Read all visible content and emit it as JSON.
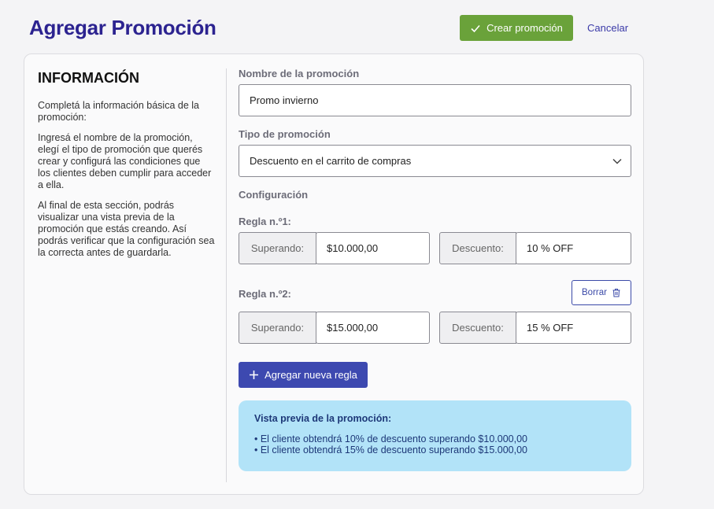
{
  "header": {
    "title": "Agregar Promoción",
    "create_label": "Crear promoción",
    "cancel_label": "Cancelar"
  },
  "info": {
    "title": "INFORMACIÓN",
    "paragraphs": [
      "Completá la información básica de la promoción:",
      "Ingresá el nombre de la promoción, elegí el tipo de promoción que querés crear y configurá las condiciones que los clientes deben cumplir para acceder a ella.",
      "Al final de esta sección, podrás visualizar una vista previa de la promoción que estás creando. Así podrás verificar que la configuración sea la correcta antes de guardarla."
    ]
  },
  "form": {
    "name_label": "Nombre de la promoción",
    "name_value": "Promo invierno",
    "type_label": "Tipo de promoción",
    "type_value": "Descuento en el carrito de compras",
    "config_label": "Configuración",
    "rules": [
      {
        "title": "Regla n.º1:",
        "threshold_prefix": "Superando:",
        "threshold_value": "$10.000,00",
        "discount_prefix": "Descuento:",
        "discount_value": "10 % OFF"
      },
      {
        "title": "Regla n.º2:",
        "threshold_prefix": "Superando:",
        "threshold_value": "$15.000,00",
        "discount_prefix": "Descuento:",
        "discount_value": "15 % OFF"
      }
    ],
    "delete_label": "Borrar",
    "add_rule_label": "Agregar nueva regla"
  },
  "preview": {
    "title": "Vista previa de la promoción:",
    "items": [
      "• El cliente obtendrá 10% de descuento superando $10.000,00",
      "• El cliente obtendrá 15% de descuento superando $15.000,00"
    ]
  },
  "icons": {
    "create": "check-icon",
    "select": "chevron-down-icon",
    "delete": "trash-icon",
    "add": "plus-icon"
  },
  "colors": {
    "title": "#2c2390",
    "create_button": "#6aa23a",
    "add_button": "#3d49b0",
    "preview_bg": "#b2e3f8"
  }
}
